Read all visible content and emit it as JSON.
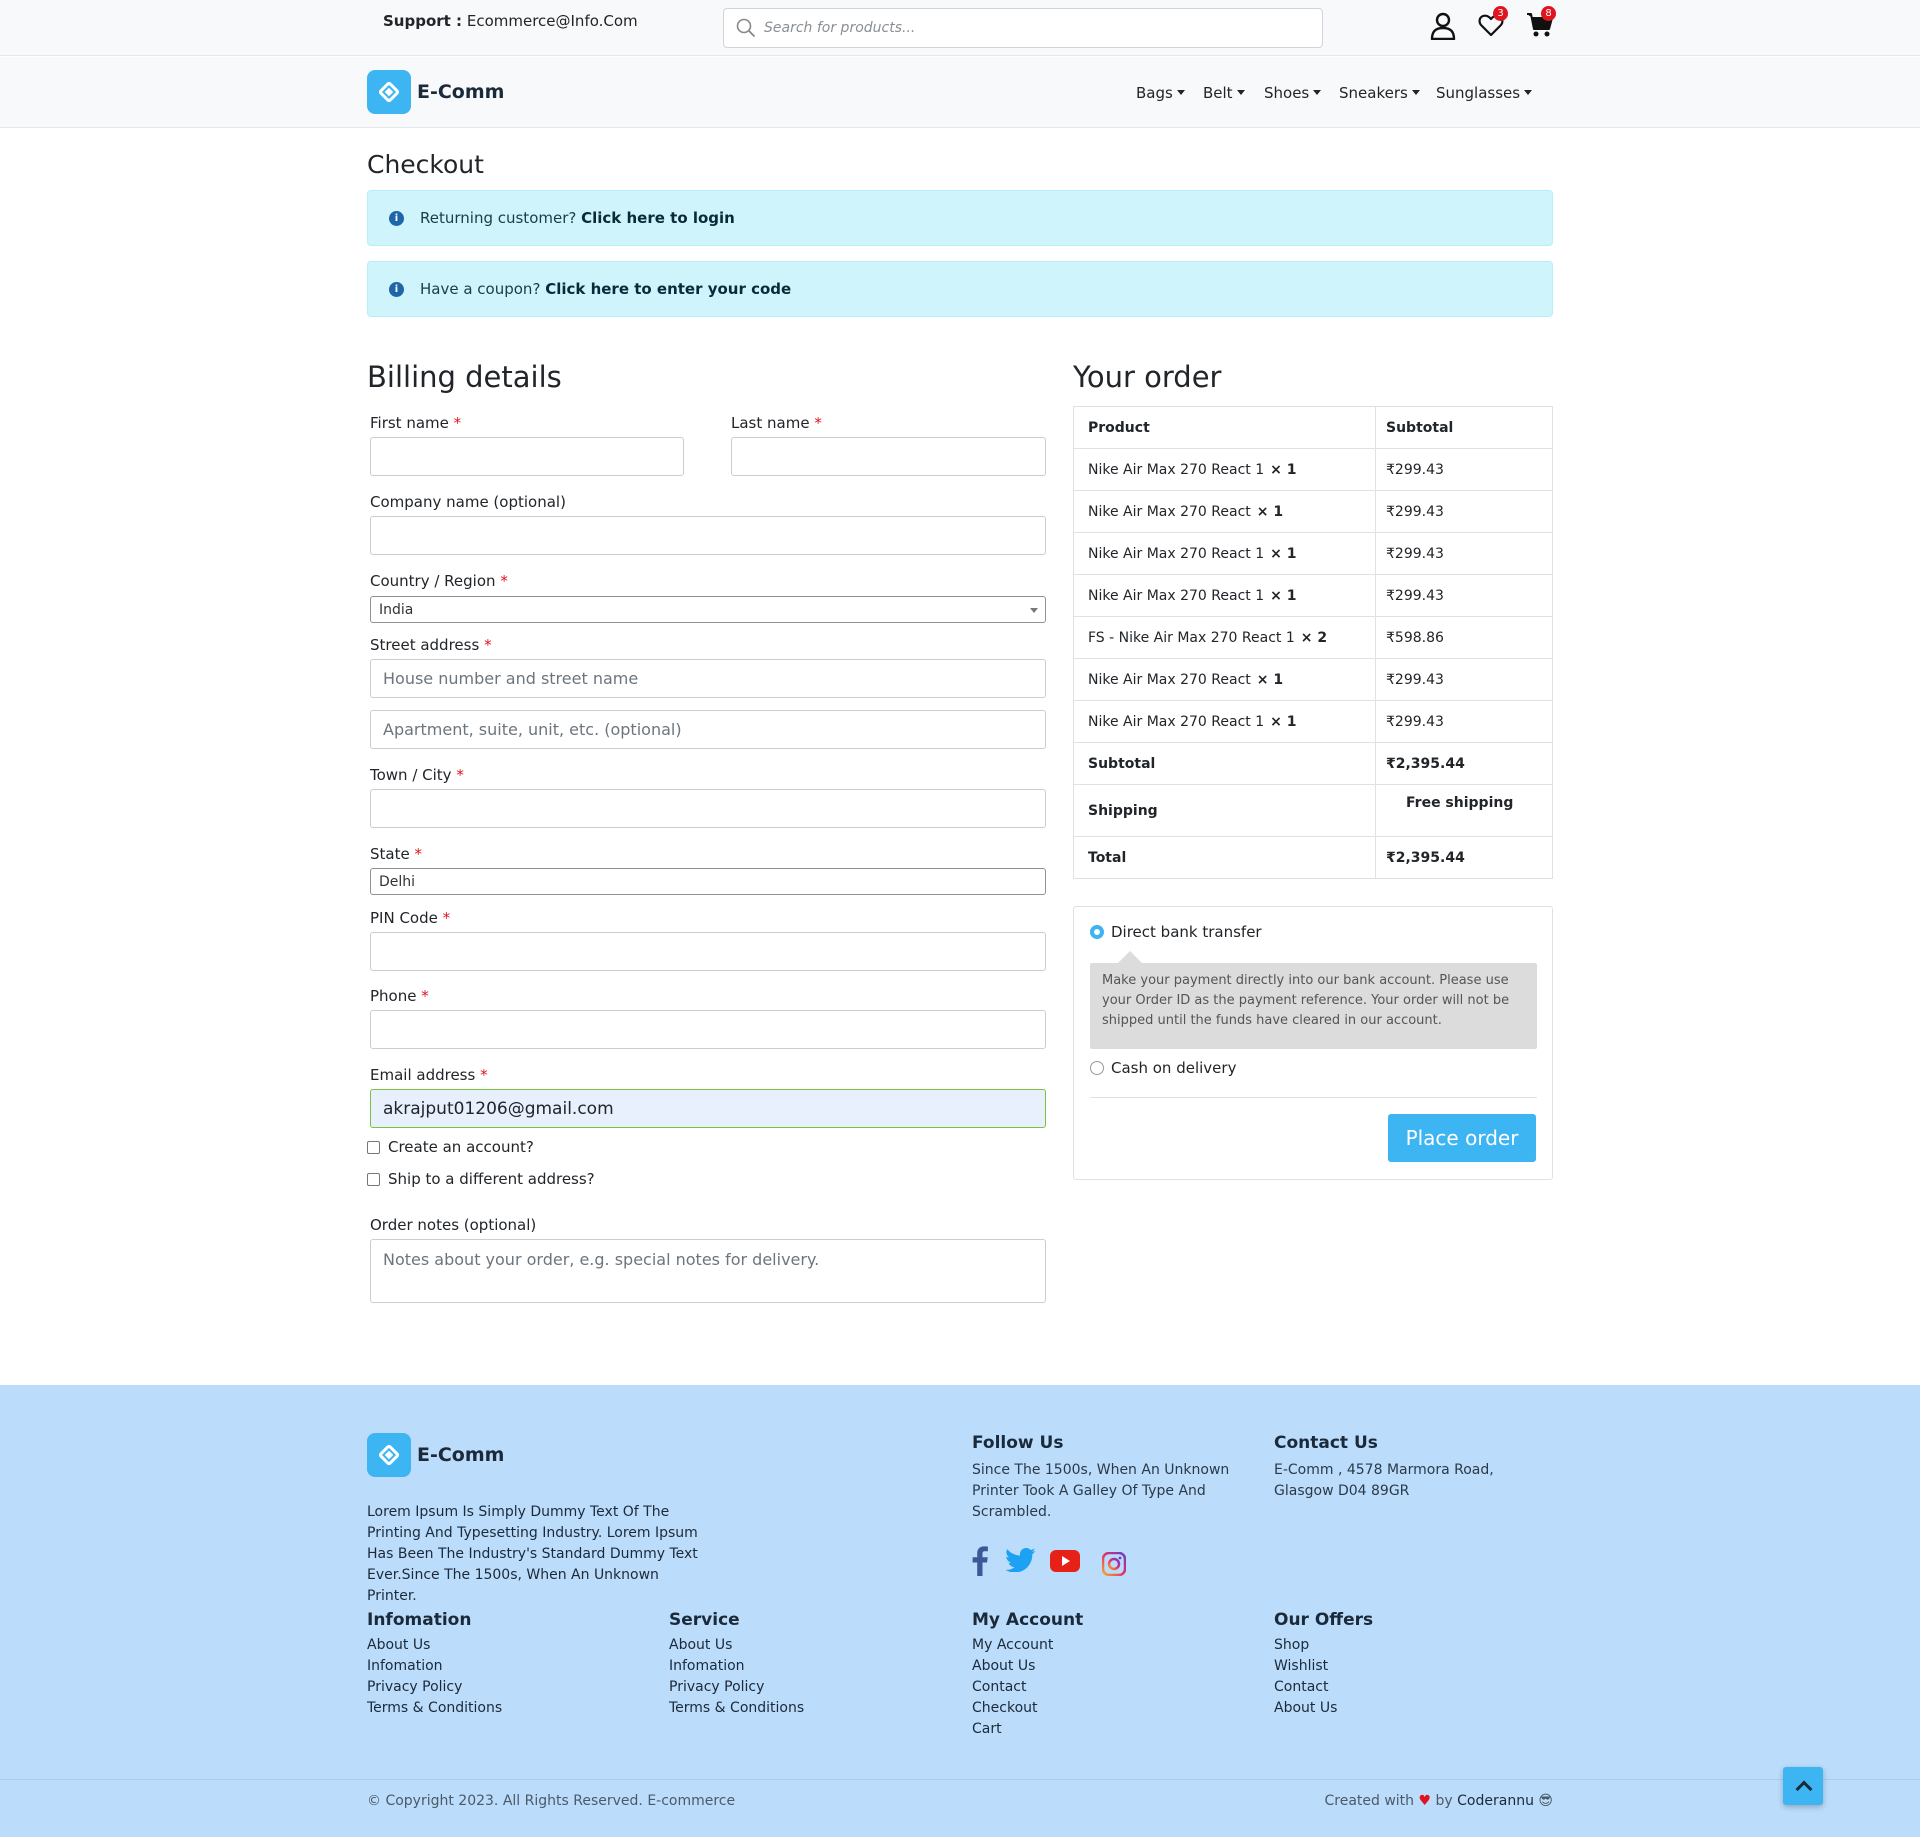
{
  "topbar": {
    "support_label": "Support :",
    "support_email": "Ecommerce@Info.Com",
    "search_placeholder": "Search for products...",
    "wishlist_count": "3",
    "cart_count": "8"
  },
  "navbar": {
    "brand": "E-Comm",
    "items": [
      "Bags",
      "Belt",
      "Shoes",
      "Sneakers",
      "Sunglasses"
    ]
  },
  "checkout": {
    "title": "Checkout",
    "returning_text": "Returning customer?",
    "returning_link": "Click here to login",
    "coupon_text": "Have a coupon?",
    "coupon_link": "Click here to enter your code"
  },
  "billing": {
    "title": "Billing details",
    "first_name": "First name",
    "last_name": "Last name",
    "company": "Company name (optional)",
    "country": "Country / Region",
    "country_value": "India",
    "street": "Street address",
    "street_placeholder_1": "House number and street name",
    "street_placeholder_2": "Apartment, suite, unit, etc. (optional)",
    "city": "Town / City",
    "state": "State",
    "state_value": "Delhi",
    "pin": "PIN Code",
    "phone": "Phone",
    "email": "Email address",
    "email_value": "akrajput01206@gmail.com",
    "create_account": "Create an account?",
    "ship_different": "Ship to a different address?",
    "notes": "Order notes (optional)",
    "notes_placeholder": "Notes about your order, e.g. special notes for delivery.",
    "required_mark": "*"
  },
  "order": {
    "title": "Your order",
    "col_product": "Product",
    "col_subtotal": "Subtotal",
    "items": [
      {
        "name": "Nike Air Max 270 React 1",
        "qty": "× 1",
        "price": "₹299.43"
      },
      {
        "name": "Nike Air Max 270 React",
        "qty": "× 1",
        "price": "₹299.43"
      },
      {
        "name": "Nike Air Max 270 React 1",
        "qty": "× 1",
        "price": "₹299.43"
      },
      {
        "name": "Nike Air Max 270 React 1",
        "qty": "× 1",
        "price": "₹299.43"
      },
      {
        "name": "FS - Nike Air Max 270 React 1",
        "qty": "× 2",
        "price": "₹598.86"
      },
      {
        "name": "Nike Air Max 270 React",
        "qty": "× 1",
        "price": "₹299.43"
      },
      {
        "name": "Nike Air Max 270 React 1",
        "qty": "× 1",
        "price": "₹299.43"
      }
    ],
    "subtotal_label": "Subtotal",
    "subtotal_value": "₹2,395.44",
    "shipping_label": "Shipping",
    "shipping_value": "Free shipping",
    "total_label": "Total",
    "total_value": "₹2,395.44"
  },
  "payment": {
    "bank_label": "Direct bank transfer",
    "bank_desc": "Make your payment directly into our bank account. Please use your Order ID as the payment reference. Your order will not be shipped until the funds have cleared in our account.",
    "cod_label": "Cash on delivery",
    "place_order": "Place order"
  },
  "footer": {
    "brand": "E-Comm",
    "about": "Lorem Ipsum Is Simply Dummy Text Of The Printing And Typesetting Industry. Lorem Ipsum Has Been The Industry's Standard Dummy Text Ever.Since The 1500s, When An Unknown Printer.",
    "follow_title": "Follow Us",
    "follow_text": "Since The 1500s, When An Unknown Printer Took A Galley Of Type And Scrambled.",
    "contact_title": "Contact Us",
    "contact_text": "E-Comm , 4578 Marmora Road, Glasgow D04 89GR",
    "columns": [
      {
        "title": "Infomation",
        "links": [
          "About Us",
          "Infomation",
          "Privacy Policy",
          "Terms & Conditions"
        ]
      },
      {
        "title": "Service",
        "links": [
          "About Us",
          "Infomation",
          "Privacy Policy",
          "Terms & Conditions"
        ]
      },
      {
        "title": "My Account",
        "links": [
          "My Account",
          "About Us",
          "Contact",
          "Checkout",
          "Cart"
        ]
      },
      {
        "title": "Our Offers",
        "links": [
          "Shop",
          "Wishlist",
          "Contact",
          "About Us"
        ]
      }
    ],
    "copyright": "© Copyright 2023. All Rights Reserved. E-commerce",
    "created_prefix": "Created with",
    "created_by": "by",
    "created_name": "Coderannu",
    "colors": {
      "facebook": "#3b5998",
      "twitter": "#1da1f2",
      "youtube": "#e62117",
      "accent": "#3db5f2",
      "footer_bg": "#bcdcfb"
    }
  }
}
